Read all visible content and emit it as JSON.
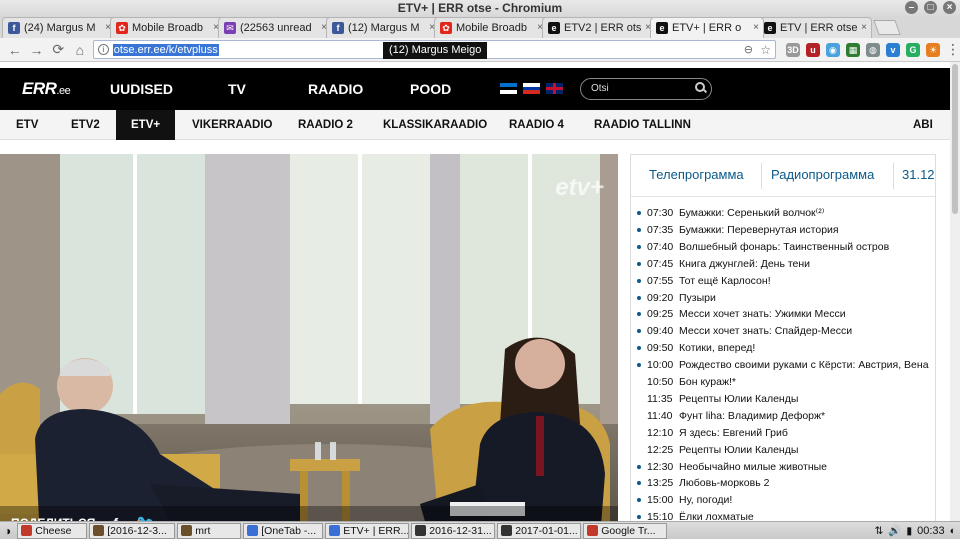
{
  "window": {
    "title": "ETV+ | ERR otse - Chromium"
  },
  "browser": {
    "tabs": [
      {
        "label": "(24) Margus M",
        "icon": "facebook-icon",
        "color": "#3b5998",
        "glyph": "f"
      },
      {
        "label": "Mobile Broadb",
        "icon": "huawei-icon",
        "color": "#e1261c",
        "glyph": "✿"
      },
      {
        "label": "(22563 unread",
        "icon": "mail-icon",
        "color": "#7b3fb3",
        "glyph": "✉"
      },
      {
        "label": "(12) Margus M",
        "icon": "facebook-icon",
        "color": "#3b5998",
        "glyph": "f"
      },
      {
        "label": "Mobile Broadb",
        "icon": "huawei-icon",
        "color": "#e1261c",
        "glyph": "✿"
      },
      {
        "label": "ETV2 | ERR ots",
        "icon": "err-icon",
        "color": "#111",
        "glyph": "e"
      },
      {
        "label": "ETV+ | ERR o",
        "icon": "err-icon",
        "color": "#111",
        "glyph": "e"
      },
      {
        "label": "ETV | ERR otse",
        "icon": "err-icon",
        "color": "#111",
        "glyph": "e"
      }
    ],
    "url": "otse.err.ee/k/etvpluss",
    "tooltip": "(12) Margus Meigo"
  },
  "site": {
    "logo_main": "ERR",
    "logo_suffix": ".ee",
    "nav": [
      "UUDISED",
      "TV",
      "RAADIO",
      "POOD"
    ],
    "search_placeholder": "Otsi",
    "channels": [
      "ETV",
      "ETV2",
      "ETV+",
      "VIKERRAADIO",
      "RAADIO 2",
      "KLASSIKARAADIO",
      "RAADIO 4",
      "RAADIO TALLINN",
      "ABI"
    ],
    "active_channel": "ETV+"
  },
  "video": {
    "channel_logo": "etv+",
    "share_label": "ПОДЕЛИТЬСЯ"
  },
  "schedule": {
    "tab_tv": "Телепрограмма",
    "tab_radio": "Радиопрограмма",
    "date": "31.12",
    "items": [
      {
        "time": "07:30",
        "title": "Бумажки: Серенький волчок⁽²⁾",
        "past": true
      },
      {
        "time": "07:35",
        "title": "Бумажки: Перевернутая история",
        "past": true
      },
      {
        "time": "07:40",
        "title": "Волшебный фонарь: Таинственный остров",
        "past": true
      },
      {
        "time": "07:45",
        "title": "Книга джунглей: День тени",
        "past": true
      },
      {
        "time": "07:55",
        "title": "Тот ещё Карлосон!",
        "past": true
      },
      {
        "time": "09:20",
        "title": "Пузыри",
        "past": true
      },
      {
        "time": "09:25",
        "title": "Месси хочет знать: Ужимки Месси",
        "past": true
      },
      {
        "time": "09:40",
        "title": "Месси хочет знать: Спайдер-Месси",
        "past": true
      },
      {
        "time": "09:50",
        "title": "Котики, вперед!",
        "past": true
      },
      {
        "time": "10:00",
        "title": "Рождество своими руками с Кёрсти: Австрия, Вена",
        "past": true
      },
      {
        "time": "10:50",
        "title": "Бон кураж!*",
        "past": false
      },
      {
        "time": "11:35",
        "title": "Рецепты Юлии Календы",
        "past": false
      },
      {
        "time": "11:40",
        "title": "Фунт liha: Владимир Дефорж*",
        "past": false
      },
      {
        "time": "12:10",
        "title": "Я здесь: Евгений Гриб",
        "past": false
      },
      {
        "time": "12:25",
        "title": "Рецепты Юлии Календы",
        "past": false
      },
      {
        "time": "12:30",
        "title": "Необычайно милые животные",
        "past": true
      },
      {
        "time": "13:25",
        "title": "Любовь-морковь 2",
        "past": true
      },
      {
        "time": "15:00",
        "title": "Ну, погоди!",
        "past": true
      },
      {
        "time": "15:10",
        "title": "Ёлки лохматые",
        "past": true
      }
    ]
  },
  "taskbar": {
    "tasks": [
      {
        "label": "Cheese",
        "color": "#c0392b"
      },
      {
        "label": "[2016-12-3...",
        "color": "#6b4f2a"
      },
      {
        "label": "mrt",
        "color": "#6b4f2a"
      },
      {
        "label": "[OneTab -...",
        "color": "#3b6fd6"
      },
      {
        "label": "ETV+ | ERR...",
        "color": "#3b6fd6"
      },
      {
        "label": "2016-12-31...",
        "color": "#333"
      },
      {
        "label": "2017-01-01...",
        "color": "#333"
      },
      {
        "label": "Google Tr...",
        "color": "#c0392b"
      }
    ],
    "clock": "00:33"
  }
}
